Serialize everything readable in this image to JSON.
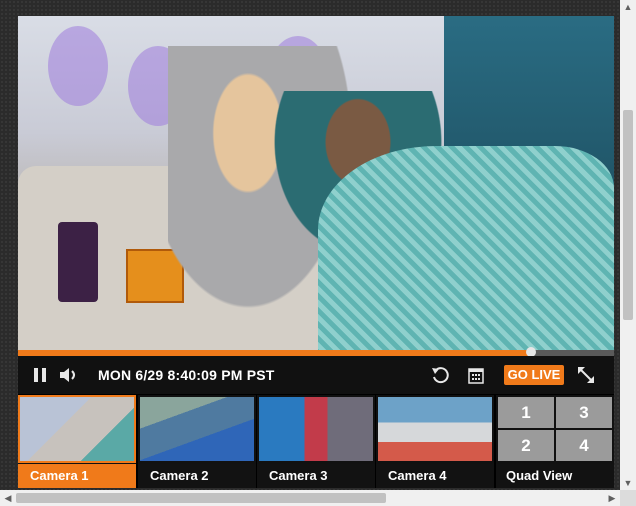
{
  "player": {
    "timestamp": "MON 6/29 8:40:09 PM PST",
    "go_live_label": "GO LIVE",
    "progress": 0.86,
    "icons": {
      "pause": "pause-icon",
      "volume": "volume-icon",
      "rewind": "rewind-icon",
      "calendar": "calendar-icon",
      "fullscreen": "fullscreen-icon"
    }
  },
  "cameras": [
    {
      "label": "Camera 1",
      "active": true
    },
    {
      "label": "Camera 2",
      "active": false
    },
    {
      "label": "Camera 3",
      "active": false
    },
    {
      "label": "Camera 4",
      "active": false
    }
  ],
  "quad": {
    "label": "Quad View",
    "cells": [
      "1",
      "3",
      "2",
      "4"
    ]
  },
  "colors": {
    "accent": "#f07a1a"
  }
}
